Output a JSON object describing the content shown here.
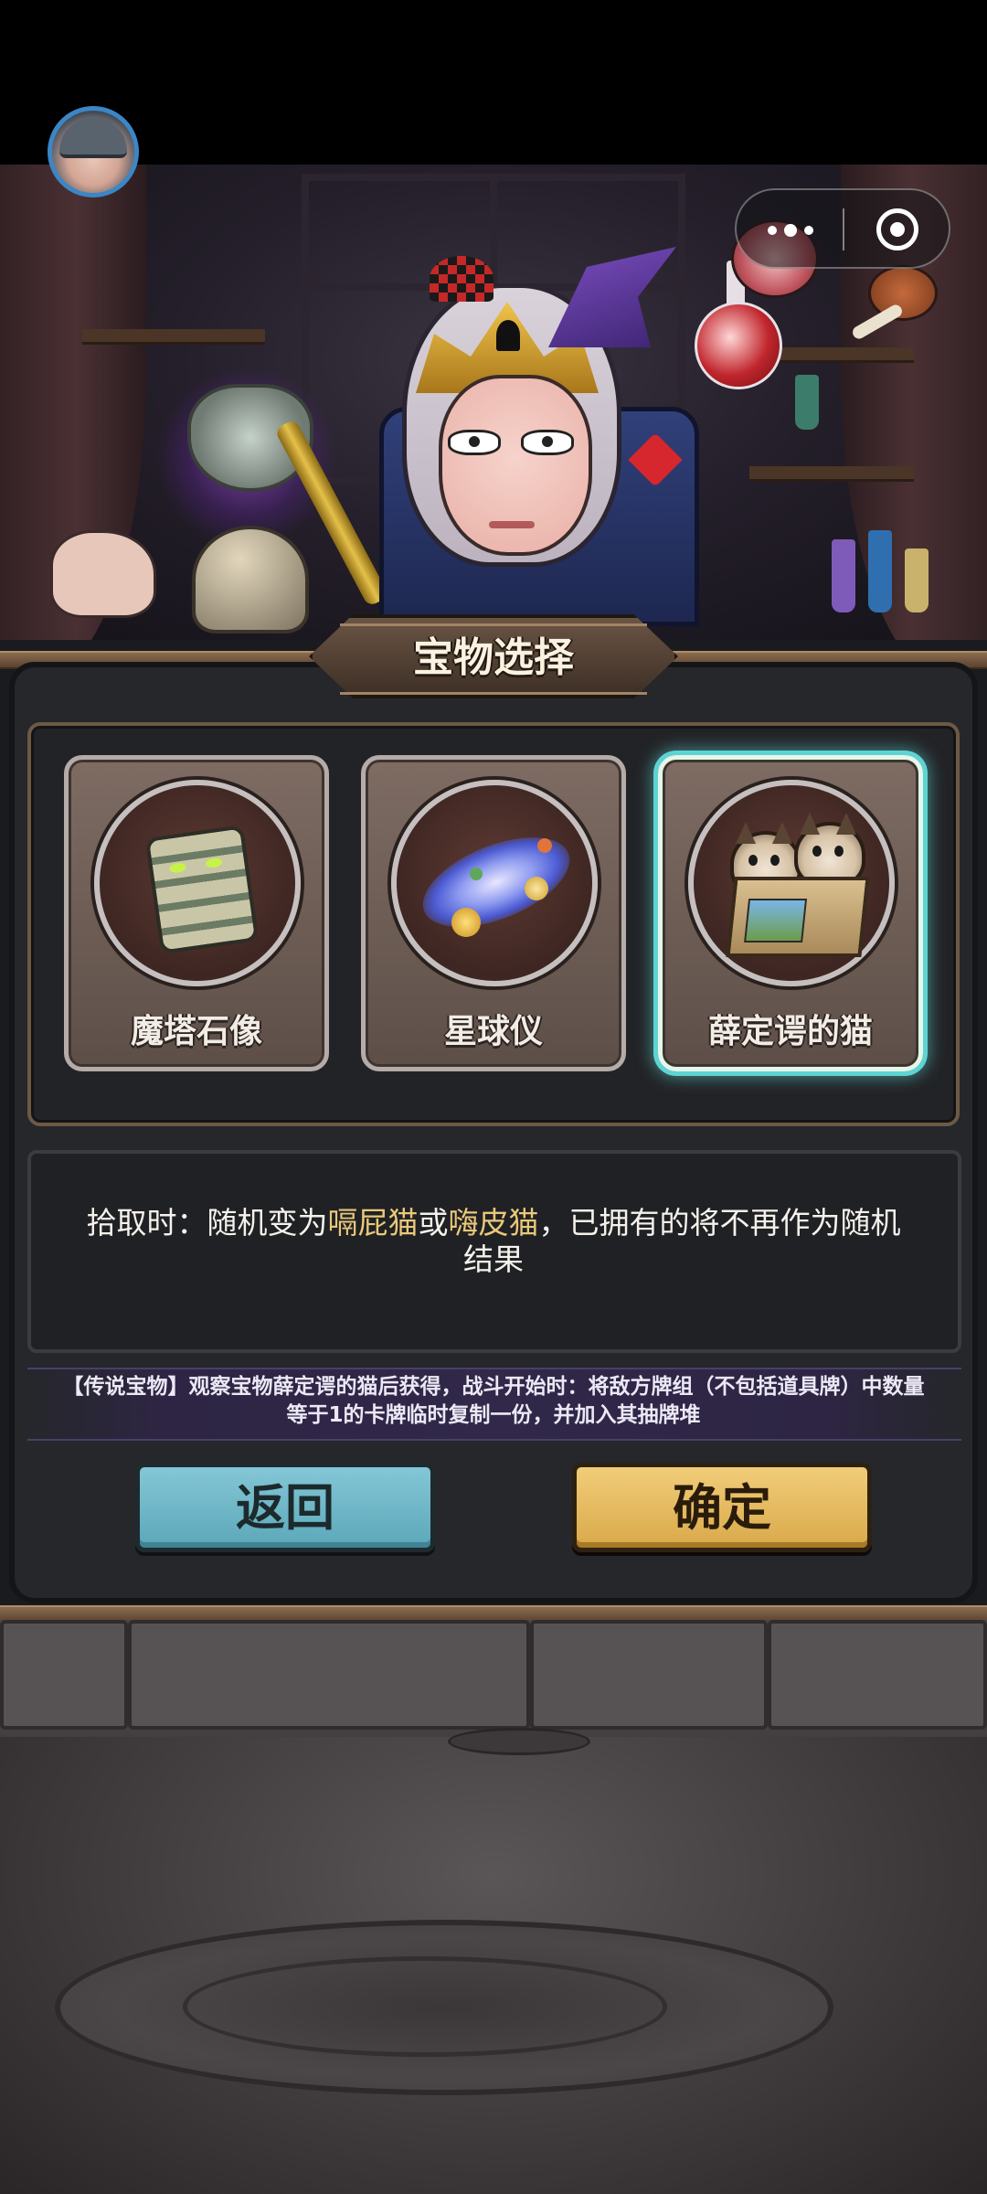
{
  "header": {
    "avatar": {
      "icon": "knight-avatar-icon",
      "ring_color": "#3c86c6"
    },
    "capsule": {
      "more_icon": "more-dots-icon",
      "close_icon": "target-close-icon"
    }
  },
  "panel": {
    "title": "宝物选择",
    "cards": [
      {
        "label": "魔塔石像",
        "icon": "stone-totem-icon",
        "selected": false
      },
      {
        "label": "星球仪",
        "icon": "galaxy-orrery-icon",
        "selected": false
      },
      {
        "label": "薛定谔的猫",
        "icon": "cats-in-box-icon",
        "selected": true
      }
    ],
    "description": {
      "prefix": "拾取时：随机变为",
      "option_a": "嗝屁猫",
      "joiner": "或",
      "option_b": "嗨皮猫",
      "suffix": "，已拥有的将不再作为随机结果"
    },
    "legend_note": "【传说宝物】观察宝物薛定谔的猫后获得，战斗开始时：将敌方牌组（不包括道具牌）中数量等于1的卡牌临时复制一份，并加入其抽牌堆",
    "buttons": {
      "back": "返回",
      "confirm": "确定"
    }
  },
  "colors": {
    "highlight": "#e9c87a",
    "selected_glow": "#5ed3d3",
    "back_button": "#6fb7c7",
    "confirm_button": "#e6bb61"
  }
}
